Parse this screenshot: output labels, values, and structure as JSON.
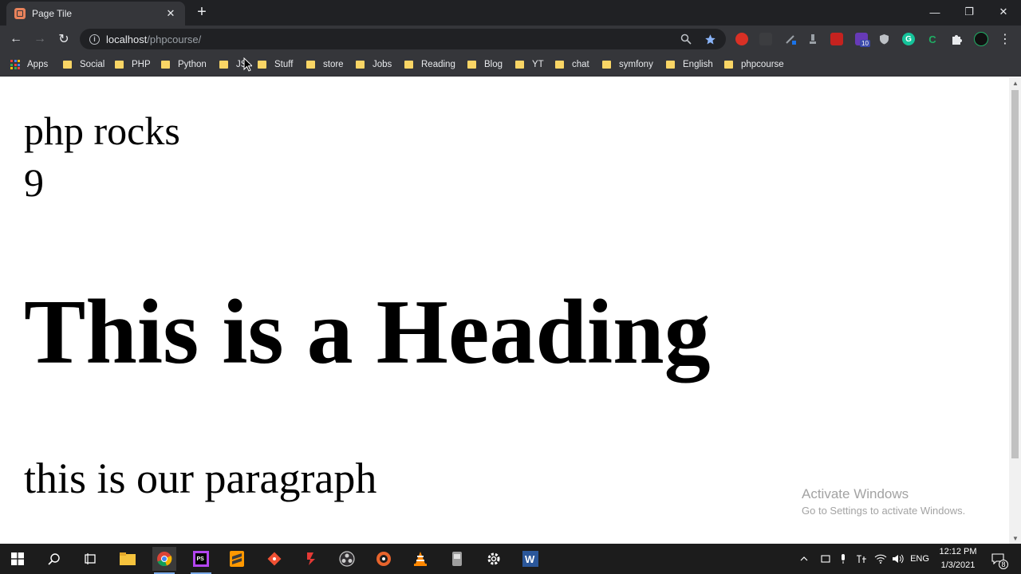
{
  "browser": {
    "tab": {
      "title": "Page Tile",
      "close": "✕"
    },
    "new_tab": "+",
    "window_controls": [
      "—",
      "❐",
      "✕"
    ],
    "nav": {
      "back": "←",
      "forward": "→",
      "reload": "↻"
    },
    "address": {
      "host": "localhost",
      "path": "/phpcourse/"
    },
    "extensions": [
      {
        "icon": "red-shield-extension-icon",
        "color": "#d93025"
      },
      {
        "icon": "gray-extension-icon",
        "color": "#5f6368"
      },
      {
        "icon": "pen-extension-icon",
        "color": "#8ab4f8"
      },
      {
        "icon": "lamp-extension-icon",
        "color": "#9aa0a6"
      },
      {
        "icon": "red-book-extension-icon",
        "color": "#c5221f"
      },
      {
        "icon": "purple-extension-icon",
        "color": "#673ab7",
        "badge": "10"
      },
      {
        "icon": "shield-extension-icon",
        "color": "#bdc1c6"
      },
      {
        "icon": "grammarly-extension-icon",
        "color": "#15c39a",
        "glyph": "G"
      },
      {
        "icon": "c-extension-icon",
        "color": "#1fae64",
        "glyph": "C"
      },
      {
        "icon": "puzzle-extensions-icon",
        "color": "#bdc1c6"
      },
      {
        "icon": "profile-avatar-icon",
        "color": "#111111"
      },
      {
        "icon": "menu-kebab-icon",
        "color": "#e8eaed",
        "glyph": "⋮"
      }
    ],
    "bookmarks": [
      {
        "label": "Apps",
        "type": "apps"
      },
      {
        "label": "Social",
        "type": "folder"
      },
      {
        "label": "PHP",
        "type": "folder"
      },
      {
        "label": "Python",
        "type": "folder"
      },
      {
        "label": "JS",
        "type": "folder"
      },
      {
        "label": "Stuff",
        "type": "folder"
      },
      {
        "label": "store",
        "type": "folder"
      },
      {
        "label": "Jobs",
        "type": "folder"
      },
      {
        "label": "Reading",
        "type": "folder"
      },
      {
        "label": "Blog",
        "type": "folder"
      },
      {
        "label": "YT",
        "type": "folder"
      },
      {
        "label": "chat",
        "type": "folder"
      },
      {
        "label": "symfony",
        "type": "folder"
      },
      {
        "label": "English",
        "type": "folder"
      },
      {
        "label": "phpcourse",
        "type": "folder"
      }
    ]
  },
  "page": {
    "line1": "php rocks",
    "line2": "9",
    "heading": "This is a Heading",
    "paragraph": "this is our paragraph"
  },
  "watermark": {
    "title": "Activate Windows",
    "subtitle": "Go to Settings to activate Windows."
  },
  "taskbar": {
    "apps": [
      "windows-start-icon",
      "search-icon",
      "task-view-icon",
      "file-explorer-icon",
      "chrome-icon",
      "phpstorm-icon",
      "sublime-text-icon",
      "git-icon",
      "app-red-icon",
      "obs-icon",
      "media-icon",
      "vlc-icon",
      "printer-icon",
      "settings-icon",
      "word-icon"
    ],
    "tray": {
      "language": "ENG",
      "time": "12:12 PM",
      "date": "1/3/2021",
      "notification_count": "8"
    }
  }
}
